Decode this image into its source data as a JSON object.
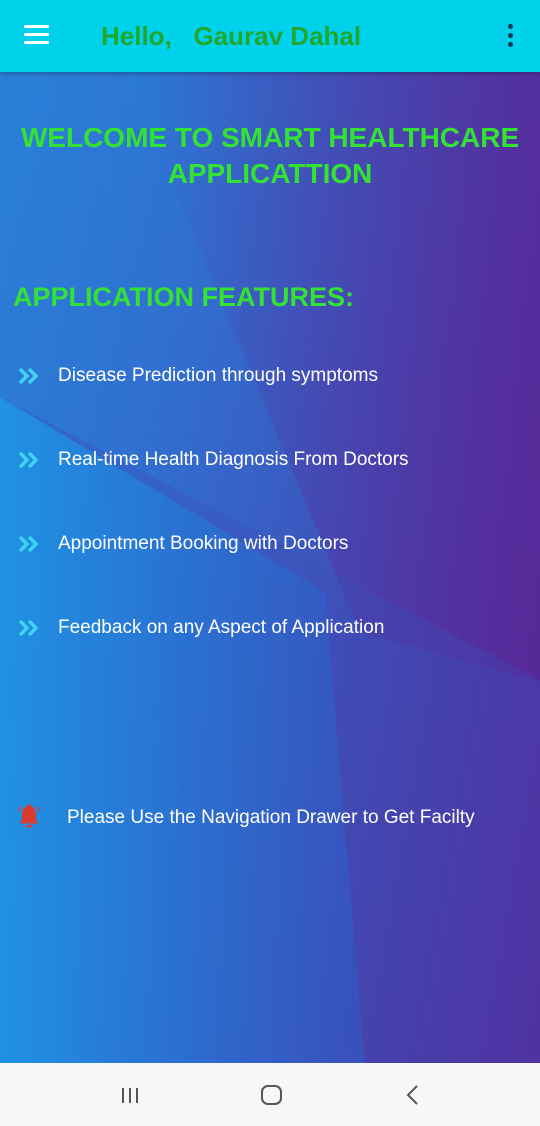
{
  "app_bar": {
    "title": "Hello,   Gaurav Dahal",
    "menu_icon": "hamburger-menu-icon",
    "overflow_icon": "more-vert-icon",
    "background_color": "#00d2ec",
    "title_color": "#1fa82b"
  },
  "main": {
    "welcome_line1": "WELCOME TO SMART HEALTHCARE",
    "welcome_line2": "APPLICATTION",
    "features_heading": "APPLICATION FEATURES:",
    "heading_color": "#33e233",
    "features": [
      {
        "label": "Disease Prediction through symptoms",
        "icon": "double-chevron-right-icon"
      },
      {
        "label": "Real-time Health Diagnosis From Doctors",
        "icon": "double-chevron-right-icon"
      },
      {
        "label": "Appointment Booking with Doctors",
        "icon": "double-chevron-right-icon"
      },
      {
        "label": "Feedback on any Aspect of Application",
        "icon": "double-chevron-right-icon"
      }
    ],
    "notice": {
      "icon": "bell-icon",
      "icon_color": "#d93b2f",
      "label": "Please Use the Navigation Drawer to Get Facilty"
    }
  },
  "system_nav": {
    "recents_icon": "recents-icon",
    "home_icon": "home-icon",
    "back_icon": "back-icon"
  }
}
